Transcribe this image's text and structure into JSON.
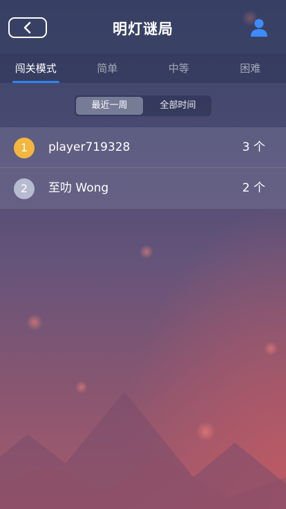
{
  "header": {
    "title": "明灯谜局",
    "back_icon": "chevron-left-icon",
    "user_icon": "user-icon",
    "accent_color": "#3d8bff"
  },
  "tabs": [
    {
      "label": "闯关模式",
      "active": true
    },
    {
      "label": "简单",
      "active": false
    },
    {
      "label": "中等",
      "active": false
    },
    {
      "label": "困难",
      "active": false
    }
  ],
  "time_filter": [
    {
      "label": "最近一周",
      "active": true
    },
    {
      "label": "全部时间",
      "active": false
    }
  ],
  "leaderboard": [
    {
      "rank": "1",
      "name": "player719328",
      "count": "3 个",
      "badge_color": "#f3b63f"
    },
    {
      "rank": "2",
      "name": "至叻 Wong",
      "count": "2 个",
      "badge_color": "#b7bbd0"
    }
  ]
}
